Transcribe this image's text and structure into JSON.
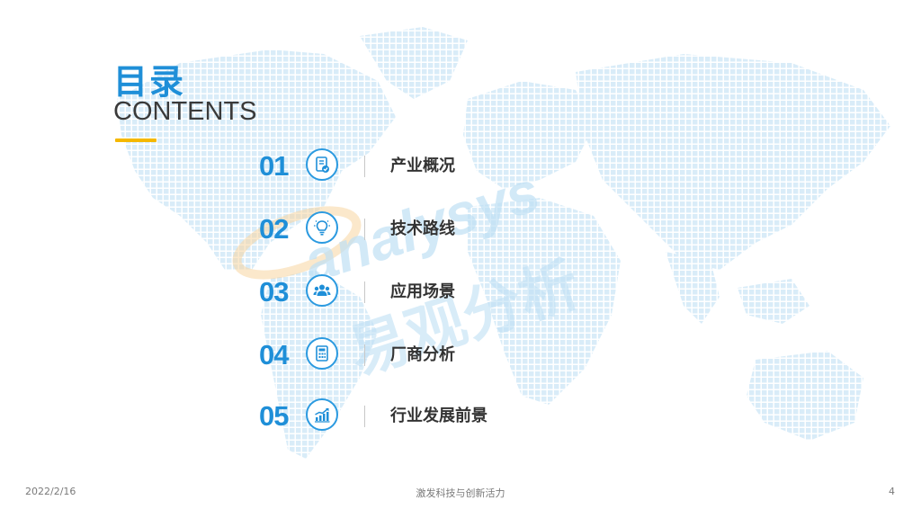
{
  "header": {
    "title_cn": "目录",
    "title_en": "CONTENTS",
    "accent_color": "#f5b800",
    "title_color": "#1f8fd8"
  },
  "toc": [
    {
      "number": "01",
      "label": "产业概况",
      "icon": "document-check-icon"
    },
    {
      "number": "02",
      "label": "技术路线",
      "icon": "lightbulb-icon"
    },
    {
      "number": "03",
      "label": "应用场景",
      "icon": "users-group-icon"
    },
    {
      "number": "04",
      "label": "厂商分析",
      "icon": "calculator-icon"
    },
    {
      "number": "05",
      "label": "行业发展前景",
      "icon": "growth-chart-icon"
    }
  ],
  "watermark": {
    "text_en": "analysys",
    "text_cn": "易观分析"
  },
  "footer": {
    "date": "2022/2/16",
    "slogan": "激发科技与创新活力",
    "page_number": "4"
  }
}
